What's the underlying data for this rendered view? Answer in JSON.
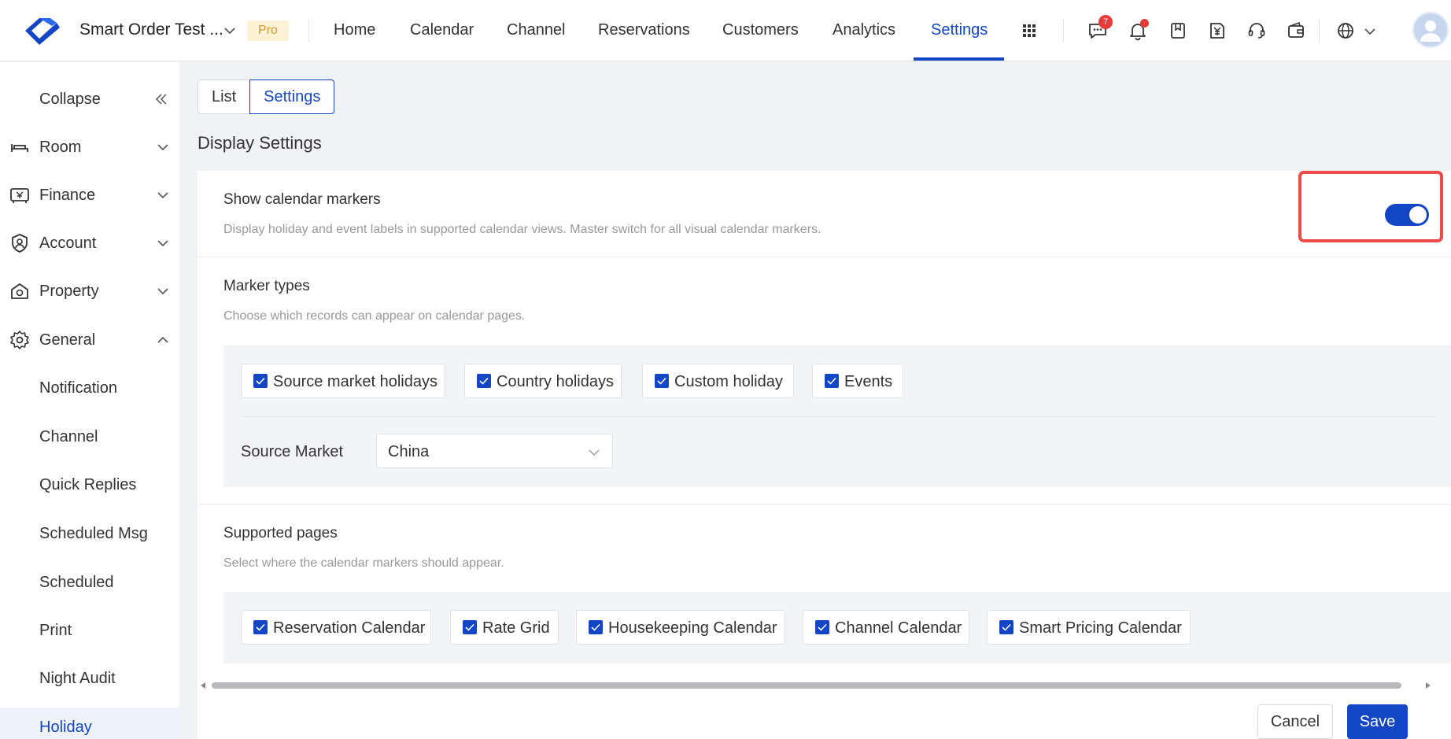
{
  "header": {
    "app_title": "Smart Order Test ...",
    "plan_badge": "Pro",
    "nav": [
      {
        "label": "Home"
      },
      {
        "label": "Calendar"
      },
      {
        "label": "Channel"
      },
      {
        "label": "Reservations"
      },
      {
        "label": "Customers"
      },
      {
        "label": "Analytics"
      },
      {
        "label": "Settings",
        "active": true
      }
    ],
    "messages_count": "7",
    "icons": [
      "apps-grid-icon",
      "messages-icon",
      "bell-icon",
      "bookmark-icon",
      "invoice-yen-icon",
      "headset-icon",
      "wallet-icon",
      "globe-icon",
      "avatar"
    ]
  },
  "sidebar": {
    "collapse_label": "Collapse",
    "items": [
      {
        "label": "Room",
        "icon": "bed-icon"
      },
      {
        "label": "Finance",
        "icon": "cash-register-icon"
      },
      {
        "label": "Account",
        "icon": "user-shield-icon"
      },
      {
        "label": "Property",
        "icon": "property-icon"
      },
      {
        "label": "General",
        "icon": "gear-icon",
        "expanded": true
      }
    ],
    "sub_items": [
      {
        "label": "Notification"
      },
      {
        "label": "Channel"
      },
      {
        "label": "Quick Replies"
      },
      {
        "label": "Scheduled Msg"
      },
      {
        "label": "Scheduled"
      },
      {
        "label": "Print"
      },
      {
        "label": "Night Audit"
      },
      {
        "label": "Holiday",
        "active": true
      }
    ]
  },
  "tabs": [
    {
      "label": "List"
    },
    {
      "label": "Settings",
      "active": true
    }
  ],
  "section_title": "Display Settings",
  "show_markers": {
    "title": "Show calendar markers",
    "desc": "Display holiday and event labels in supported calendar views. Master switch for all visual calendar markers.",
    "enabled": true
  },
  "marker_types": {
    "title": "Marker types",
    "desc": "Choose which records can appear on calendar pages.",
    "options": [
      {
        "label": "Source market holidays",
        "checked": true
      },
      {
        "label": "Country holidays",
        "checked": true
      },
      {
        "label": "Custom holiday",
        "checked": true
      },
      {
        "label": "Events",
        "checked": true
      }
    ],
    "source_market_label": "Source Market",
    "source_market_value": "China"
  },
  "supported_pages": {
    "title": "Supported pages",
    "desc": "Select where the calendar markers should appear.",
    "options": [
      {
        "label": "Reservation Calendar",
        "checked": true
      },
      {
        "label": "Rate Grid",
        "checked": true
      },
      {
        "label": "Housekeeping Calendar",
        "checked": true
      },
      {
        "label": "Channel Calendar",
        "checked": true
      },
      {
        "label": "Smart Pricing Calendar",
        "checked": true
      }
    ]
  },
  "footer": {
    "cancel_label": "Cancel",
    "save_label": "Save"
  },
  "colors": {
    "accent": "#1346c4",
    "highlight": "#ee4a4a",
    "pro_badge_bg": "#fdf1d6",
    "pro_badge_text": "#d59a2a"
  }
}
